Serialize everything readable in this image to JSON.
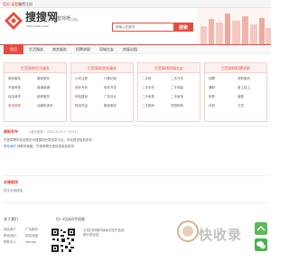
{
  "topbar": {
    "login": "您好,请登录",
    "register": "免费注册"
  },
  "header": {
    "logo_text": "搜搜网",
    "domain": "www.ssoso.com",
    "city": "巴音郭楞",
    "switch_city": "[切换]",
    "search_placeholder": "请输入关键词",
    "search_button": "搜索",
    "brand_color": "#e84b3c"
  },
  "nav": {
    "items": [
      "首页",
      "生活服务",
      "商务服务",
      "招聘求职",
      "同城交友",
      "房屋出租"
    ]
  },
  "categories": [
    {
      "title": "巴音郭楞生活服务",
      "links": [
        "家政服务",
        "搬家服务",
        "开锁修锁",
        "管道疏通",
        "保洁清洗",
        "维修服务",
        "家电维修",
        "油烟机清洗"
      ]
    },
    {
      "title": "巴音郭楞商务服务",
      "links": [
        "公司注册",
        "代理记账",
        "商标专利",
        "软件开发",
        "网站建设",
        "广告设计",
        "物流货运",
        "翻译服务"
      ]
    },
    {
      "title": "巴音郭楞同城交友",
      "links": [
        "二手房",
        "二手汽车",
        "二手手机",
        "二手电脑",
        "二手家具",
        "二手家电",
        "二手数码",
        "宠物狗狗"
      ]
    },
    {
      "title": "巴音郭楞招聘求职",
      "links": [
        "招聘",
        "求职简历",
        "兼职",
        "普工技工",
        "销售",
        "客服",
        "司机",
        "文员"
      ]
    }
  ],
  "info": {
    "title": "最新发布",
    "date": "( 最近更新：2024-02-29 17:19:51 )",
    "line1": "巴音郭楞市欢迎您访问搜搜网分类信息平台，本站提供免费发布",
    "contact": "联系我们",
    "line2": "请联系客服，巴音郭楞分类信息免费发布"
  },
  "notice": {
    "title": "友情链接",
    "text": "暂无友情链接"
  },
  "footer": {
    "col1_title": "关于我们",
    "col1_links": [
      "网站简介",
      "联系我们",
      "帮助中心"
    ],
    "col2_links": [
      "广告服务",
      "网站地图",
      "sitemap"
    ],
    "qr_title": "扫一扫访问手机版",
    "qr_caption": "手机扫码随时随地浏览巴音郭楞分类信息",
    "watermark_text": "快收录"
  }
}
